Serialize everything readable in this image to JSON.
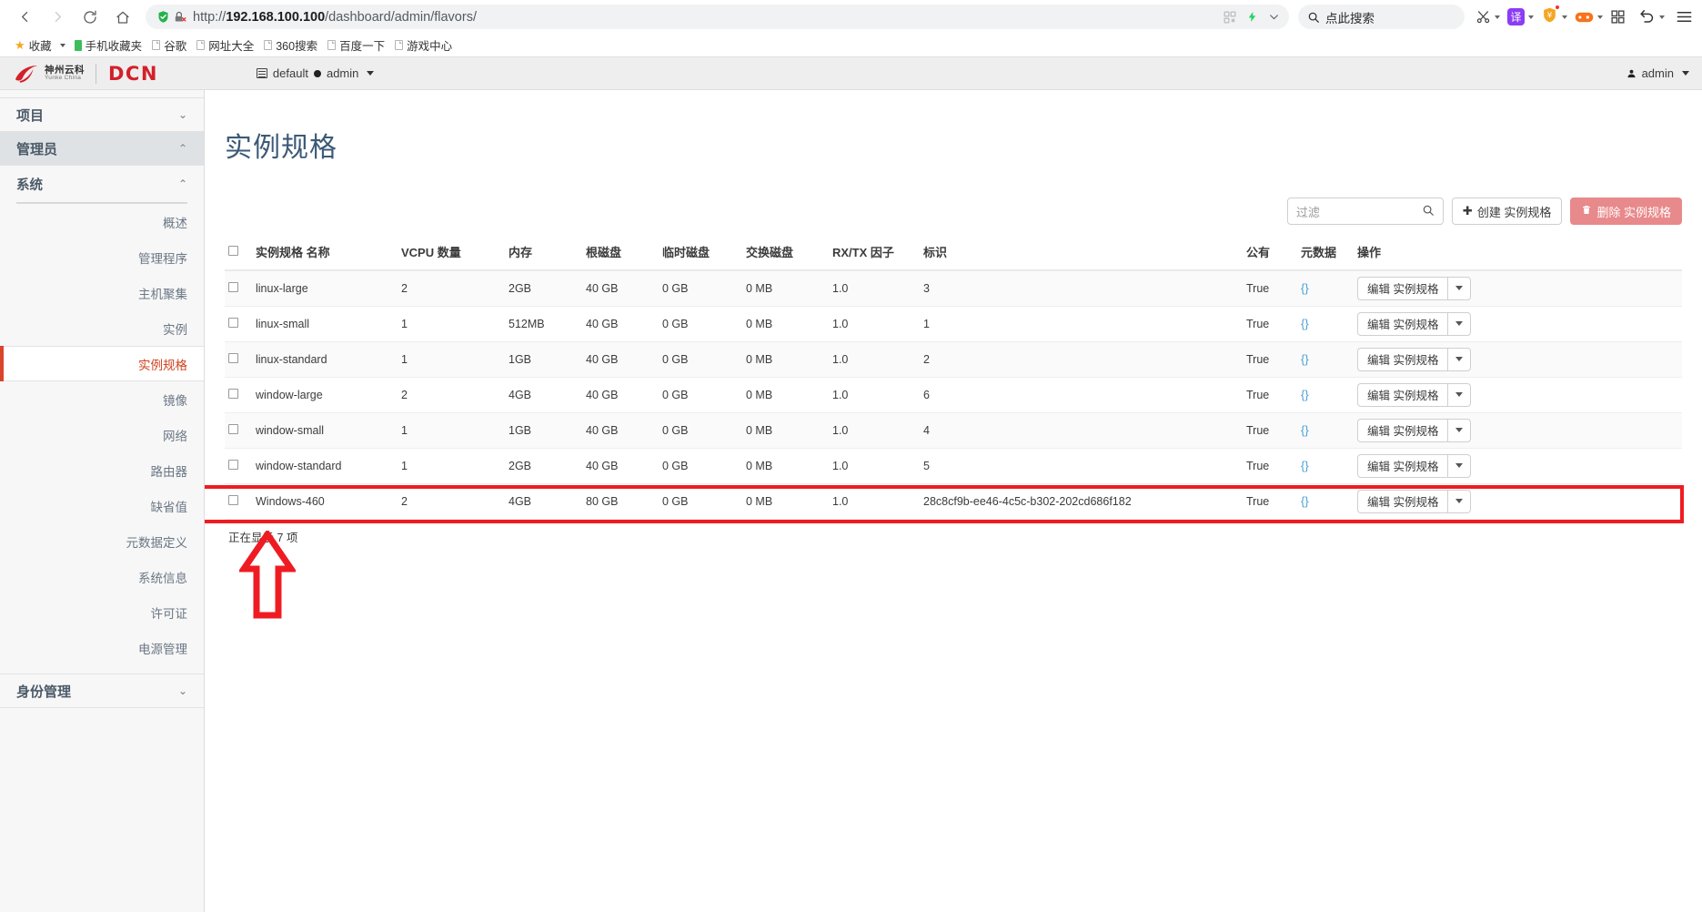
{
  "browser": {
    "nav": {
      "back": "back-arrow",
      "forward": "forward-arrow",
      "reload": "reload",
      "home": "home"
    },
    "url_prefix": "http://",
    "url_host": "192.168.100.100",
    "url_path": "/dashboard/admin/flavors/",
    "search_placeholder": "点此搜索",
    "extensions": [
      {
        "name": "scissors-icon",
        "glyph": "✂"
      },
      {
        "name": "translate-icon",
        "glyph": "译"
      },
      {
        "name": "shield-coupon-icon",
        "glyph": "¥"
      },
      {
        "name": "game-controller-icon",
        "glyph": "🎮"
      },
      {
        "name": "apps-grid-icon",
        "glyph": "▦"
      },
      {
        "name": "undo-icon",
        "glyph": "↺"
      },
      {
        "name": "menu-icon",
        "glyph": "☰"
      }
    ],
    "bookmarks": [
      {
        "label": "收藏",
        "icon": "star-icon"
      },
      {
        "label": "手机收藏夹",
        "icon": "phone-icon"
      },
      {
        "label": "谷歌",
        "icon": "page-icon"
      },
      {
        "label": "网址大全",
        "icon": "page-icon"
      },
      {
        "label": "360搜索",
        "icon": "page-icon"
      },
      {
        "label": "百度一下",
        "icon": "page-icon"
      },
      {
        "label": "游戏中心",
        "icon": "page-icon"
      }
    ]
  },
  "app_header": {
    "brand_cn_line1": "神州云科",
    "brand_cn_line2": "Yunke China",
    "brand_dcn": "DCN",
    "context_project": "default",
    "context_user": "admin",
    "account_user": "admin"
  },
  "sidebar": {
    "groups": [
      {
        "label": "项目",
        "state": "collapsed",
        "chevron": "⌄"
      },
      {
        "label": "管理员",
        "state": "expanded",
        "chevron": "⌃"
      }
    ],
    "section": {
      "label": "系统",
      "chevron": "⌃"
    },
    "items": [
      {
        "label": "概述",
        "active": false
      },
      {
        "label": "管理程序",
        "active": false
      },
      {
        "label": "主机聚集",
        "active": false
      },
      {
        "label": "实例",
        "active": false
      },
      {
        "label": "实例规格",
        "active": true
      },
      {
        "label": "镜像",
        "active": false
      },
      {
        "label": "网络",
        "active": false
      },
      {
        "label": "路由器",
        "active": false
      },
      {
        "label": "缺省值",
        "active": false
      },
      {
        "label": "元数据定义",
        "active": false
      },
      {
        "label": "系统信息",
        "active": false
      },
      {
        "label": "许可证",
        "active": false
      },
      {
        "label": "电源管理",
        "active": false
      }
    ],
    "bottom_group": {
      "label": "身份管理",
      "state": "collapsed",
      "chevron": "⌄"
    }
  },
  "main": {
    "page_title": "实例规格",
    "toolbar": {
      "filter_placeholder": "过滤",
      "filter_value": "",
      "create_label": "创建 实例规格",
      "delete_label": "删除 实例规格"
    },
    "table": {
      "columns": [
        "实例规格 名称",
        "VCPU 数量",
        "内存",
        "根磁盘",
        "临时磁盘",
        "交换磁盘",
        "RX/TX 因子",
        "标识",
        "公有",
        "元数据",
        "操作"
      ],
      "action_label": "编辑 实例规格",
      "rows": [
        {
          "name": "linux-large",
          "vcpu": "2",
          "memory": "2GB",
          "root_disk": "40 GB",
          "ephemeral": "0 GB",
          "swap": "0 MB",
          "rxtx": "1.0",
          "id": "3",
          "public": "True",
          "metadata": "{}",
          "highlight": false
        },
        {
          "name": "linux-small",
          "vcpu": "1",
          "memory": "512MB",
          "root_disk": "40 GB",
          "ephemeral": "0 GB",
          "swap": "0 MB",
          "rxtx": "1.0",
          "id": "1",
          "public": "True",
          "metadata": "{}",
          "highlight": false
        },
        {
          "name": "linux-standard",
          "vcpu": "1",
          "memory": "1GB",
          "root_disk": "40 GB",
          "ephemeral": "0 GB",
          "swap": "0 MB",
          "rxtx": "1.0",
          "id": "2",
          "public": "True",
          "metadata": "{}",
          "highlight": false
        },
        {
          "name": "window-large",
          "vcpu": "2",
          "memory": "4GB",
          "root_disk": "40 GB",
          "ephemeral": "0 GB",
          "swap": "0 MB",
          "rxtx": "1.0",
          "id": "6",
          "public": "True",
          "metadata": "{}",
          "highlight": false
        },
        {
          "name": "window-small",
          "vcpu": "1",
          "memory": "1GB",
          "root_disk": "40 GB",
          "ephemeral": "0 GB",
          "swap": "0 MB",
          "rxtx": "1.0",
          "id": "4",
          "public": "True",
          "metadata": "{}",
          "highlight": false
        },
        {
          "name": "window-standard",
          "vcpu": "1",
          "memory": "2GB",
          "root_disk": "40 GB",
          "ephemeral": "0 GB",
          "swap": "0 MB",
          "rxtx": "1.0",
          "id": "5",
          "public": "True",
          "metadata": "{}",
          "highlight": false
        },
        {
          "name": "Windows-460",
          "vcpu": "2",
          "memory": "4GB",
          "root_disk": "80 GB",
          "ephemeral": "0 GB",
          "swap": "0 MB",
          "rxtx": "1.0",
          "id": "28c8cf9b-ee46-4c5c-b302-202cd686f182",
          "public": "True",
          "metadata": "{}",
          "highlight": true
        }
      ]
    },
    "footer_count": "正在显示 7 项"
  },
  "annotations": {
    "highlight_color": "#ee1c22",
    "arrow_direction": "up"
  }
}
